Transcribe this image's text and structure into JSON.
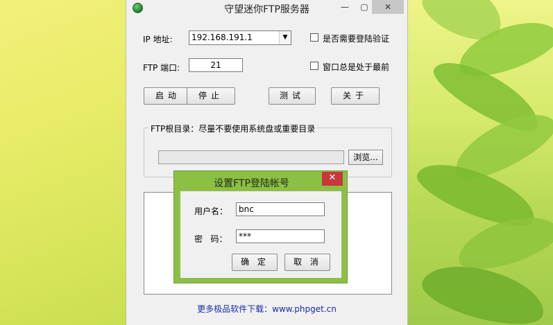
{
  "window": {
    "title": "守望迷你FTP服务器",
    "controls": {
      "minimize": "—",
      "maximize": "▢",
      "close": "✕"
    }
  },
  "form": {
    "ip_label": "IP 地址:",
    "ip_value": "192.168.191.1",
    "port_label": "FTP 端口:",
    "port_value": "21",
    "require_login_label": "是否需要登陆验证",
    "require_login_checked": false,
    "always_on_top_label": "窗口总是处于最前",
    "always_on_top_checked": false
  },
  "buttons": {
    "start": "启动",
    "stop": "停止",
    "test": "测试",
    "about": "关于"
  },
  "ftp_root": {
    "group_title": "FTP根目录：尽量不要使用系统盘或重要目录",
    "path_value": "",
    "browse_label": "浏览..."
  },
  "footer": {
    "link_text": "更多极品软件下载：www.phpget.cn"
  },
  "login_dialog": {
    "title": "设置FTP登陆帐号",
    "close": "✕",
    "username_label": "用户名：",
    "username_value": "bnc",
    "password_label": "密   码：",
    "password_value": "***",
    "ok_label": "确 定",
    "cancel_label": "取 消"
  },
  "colors": {
    "dialog_accent": "#8cc045",
    "close_button": "#c7383a",
    "footer_link": "#1a2aa8"
  }
}
